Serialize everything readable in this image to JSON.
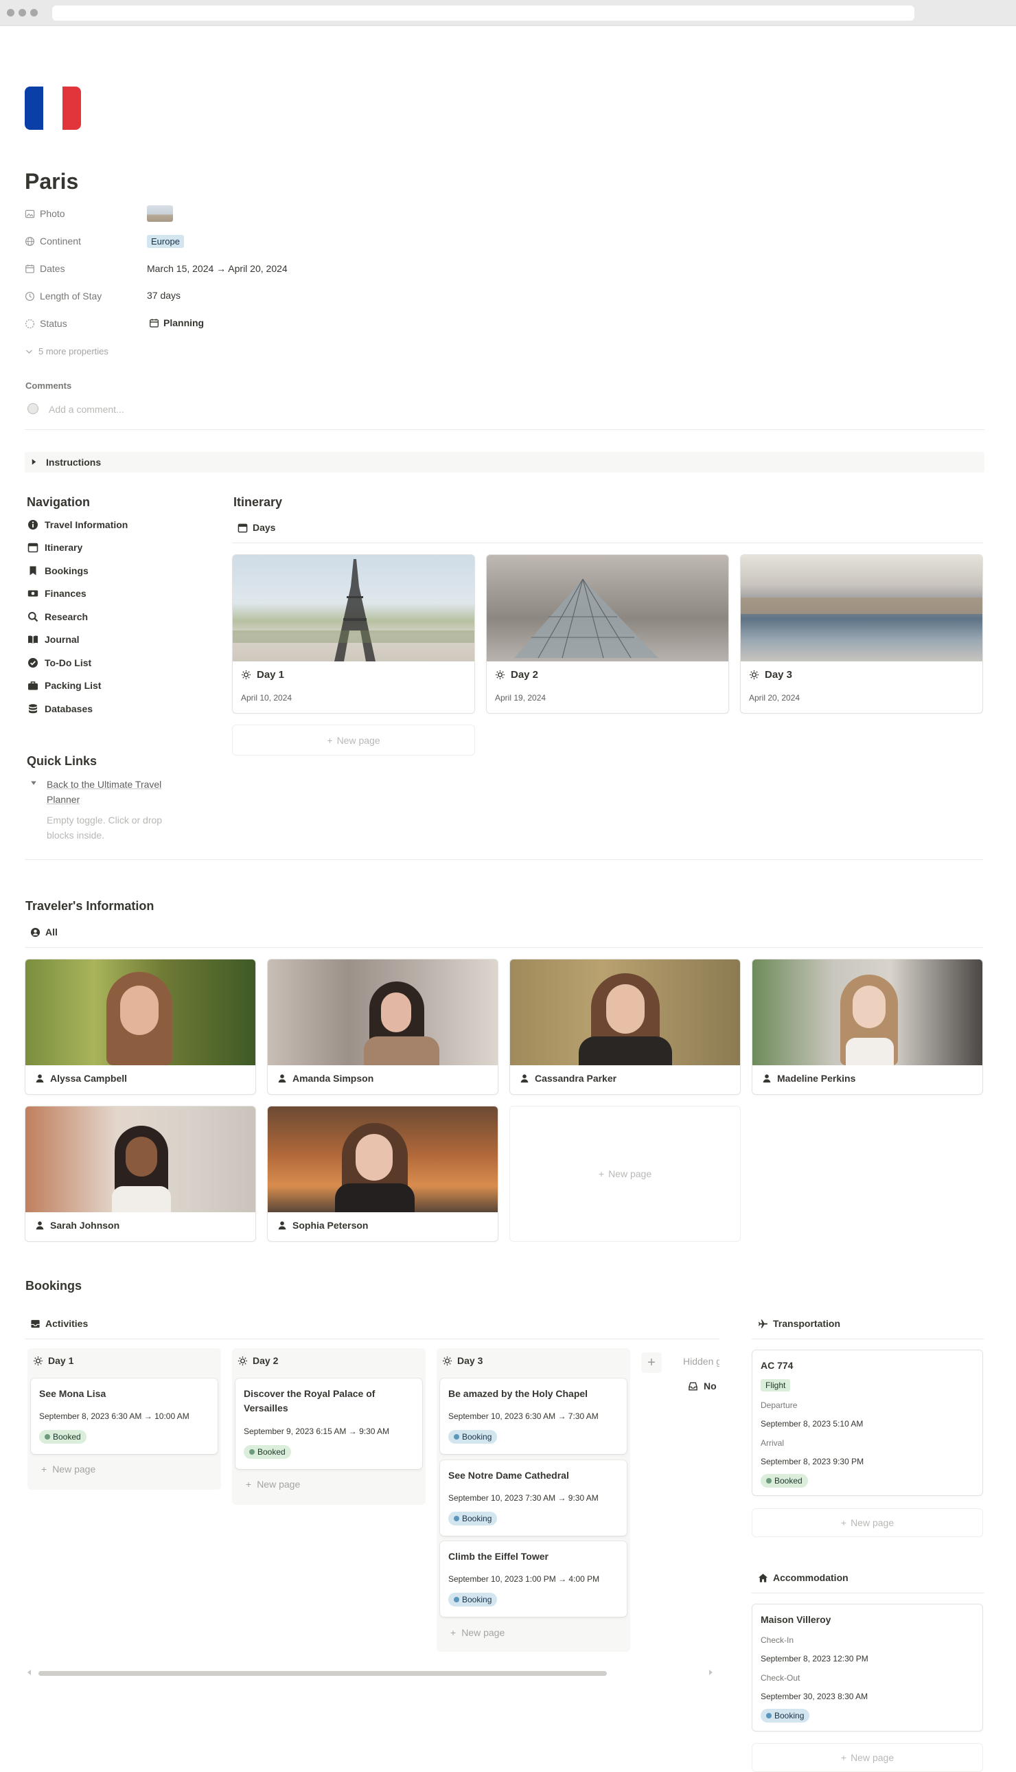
{
  "page": {
    "title": "Paris",
    "flag_colors": [
      "#0b3fa8",
      "#ffffff",
      "#e2353b"
    ]
  },
  "properties": {
    "photo_label": "Photo",
    "continent_label": "Continent",
    "continent_value": "Europe",
    "dates_label": "Dates",
    "dates_value": "March 15, 2024 → April 20, 2024",
    "length_label": "Length of Stay",
    "length_value": "37 days",
    "status_label": "Status",
    "status_value": "Planning",
    "more_label": "5 more properties"
  },
  "comments": {
    "title": "Comments",
    "placeholder": "Add a comment..."
  },
  "instructions": {
    "label": "Instructions"
  },
  "navigation": {
    "title": "Navigation",
    "items": [
      {
        "label": "Travel Information",
        "icon": "info-icon"
      },
      {
        "label": "Itinerary",
        "icon": "calendar-icon"
      },
      {
        "label": "Bookings",
        "icon": "bookmark-icon"
      },
      {
        "label": "Finances",
        "icon": "money-icon"
      },
      {
        "label": "Research",
        "icon": "search-icon"
      },
      {
        "label": "Journal",
        "icon": "book-icon"
      },
      {
        "label": "To-Do List",
        "icon": "check-circle-icon"
      },
      {
        "label": "Packing List",
        "icon": "suitcase-icon"
      },
      {
        "label": "Databases",
        "icon": "database-icon"
      }
    ]
  },
  "quick_links": {
    "title": "Quick Links",
    "toggle_label_1": "Back to the Ultimate Travel",
    "toggle_label_2": "Planner",
    "empty_1": "Empty toggle. Click or drop",
    "empty_2": "blocks inside."
  },
  "itinerary": {
    "title": "Itinerary",
    "view": "Days",
    "cards": [
      {
        "title": "Day 1",
        "date": "April 10, 2024"
      },
      {
        "title": "Day 2",
        "date": "April 19, 2024"
      },
      {
        "title": "Day 3",
        "date": "April 20, 2024"
      }
    ],
    "new_page": "New page"
  },
  "travelers": {
    "title": "Traveler's Information",
    "view": "All",
    "people": [
      {
        "name": "Alyssa Campbell"
      },
      {
        "name": "Amanda Simpson"
      },
      {
        "name": "Cassandra Parker"
      },
      {
        "name": "Madeline Perkins"
      },
      {
        "name": "Sarah Johnson"
      },
      {
        "name": "Sophia Peterson"
      }
    ],
    "new_page": "New page"
  },
  "bookings": {
    "title": "Bookings",
    "activities_view": "Activities",
    "columns": [
      {
        "name": "Day 1",
        "cards": [
          {
            "title": "See Mona Lisa",
            "time": "September 8, 2023 6:30 AM → 10:00 AM",
            "status": "Booked"
          }
        ]
      },
      {
        "name": "Day 2",
        "cards": [
          {
            "title_1": "Discover the Royal Palace of",
            "title_2": "Versailles",
            "time": "September 9, 2023 6:15 AM → 9:30 AM",
            "status": "Booked"
          }
        ]
      },
      {
        "name": "Day 3",
        "cards": [
          {
            "title": "Be amazed by the Holy Chapel",
            "time": "September 10, 2023 6:30 AM → 7:30 AM",
            "status": "Booking"
          },
          {
            "title": "See Notre Dame Cathedral",
            "time": "September 10, 2023 7:30 AM → 9:30 AM",
            "status": "Booking"
          },
          {
            "title": "Climb the Eiffel Tower",
            "time": "September 10, 2023 1:00 PM → 4:00 PM",
            "status": "Booking"
          }
        ]
      }
    ],
    "hidden_label": "Hidden g",
    "hidden_item": "No",
    "new_page": "New page",
    "transportation": {
      "title": "Transportation",
      "card": {
        "name": "AC 774",
        "type": "Flight",
        "departure_label": "Departure",
        "departure": "September 8, 2023 5:10 AM",
        "arrival_label": "Arrival",
        "arrival": "September 8, 2023 9:30 PM",
        "status": "Booked"
      },
      "new_page": "New page"
    },
    "accommodation": {
      "title": "Accommodation",
      "card": {
        "name": "Maison Villeroy",
        "checkin_label": "Check-In",
        "checkin": "September 8, 2023 12:30 PM",
        "checkout_label": "Check-Out",
        "checkout": "September 30, 2023 8:30 AM",
        "status": "Booking"
      },
      "new_page": "New page"
    }
  }
}
